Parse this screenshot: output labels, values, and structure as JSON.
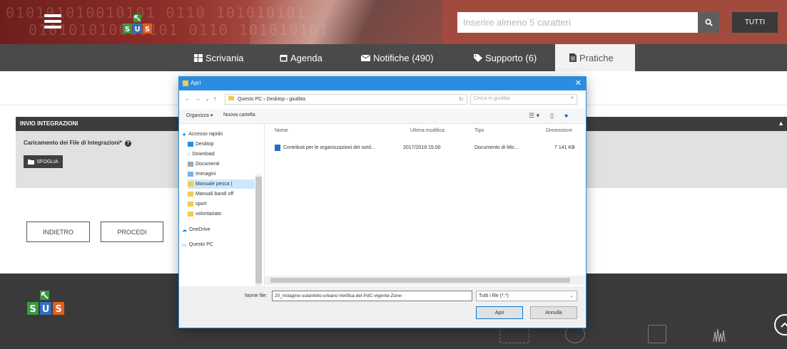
{
  "header": {
    "binary_bg": "010101010010101 0110 101010101",
    "search_placeholder": "Inserire almeno 5 caratteri",
    "search_icon": "search-icon",
    "scope_label": "TUTTI",
    "logo_letters": [
      "S",
      "U",
      "S"
    ]
  },
  "nav": {
    "items": [
      {
        "label": "Scrivania",
        "icon": "grid-icon"
      },
      {
        "label": "Agenda",
        "icon": "calendar-icon"
      },
      {
        "label": "Notifiche (490)",
        "icon": "envelope-icon"
      },
      {
        "label": "Supporto (6)",
        "icon": "tag-icon"
      },
      {
        "label": "Pratiche",
        "icon": "document-icon"
      }
    ]
  },
  "panel": {
    "title": "INVIO INTEGRAZIONI",
    "upload_label": "Caricamento dei File di Integrazioni*",
    "upload_button": "SFOGLIA"
  },
  "buttons": {
    "back": "INDIETRO",
    "next": "PROCEDI"
  },
  "dialog": {
    "title": "Apri",
    "close": "✕",
    "address": "Questo PC  ›  Desktop  ›  giuditta",
    "search_placeholder": "Cerca in giuditta",
    "toolbar": {
      "organize": "Organizza ▾",
      "new_folder": "Nuova cartella"
    },
    "tree": [
      {
        "label": "Accesso rapido",
        "icon": "star-icon"
      },
      {
        "label": "Desktop",
        "icon": "desktop-icon"
      },
      {
        "label": "Download",
        "icon": "download-icon"
      },
      {
        "label": "Documenti",
        "icon": "documents-icon"
      },
      {
        "label": "Immagini",
        "icon": "pictures-icon"
      },
      {
        "label": "Manuale pesca (",
        "icon": "folder-icon"
      },
      {
        "label": "Manuali bandi off",
        "icon": "folder-icon"
      },
      {
        "label": "sport",
        "icon": "folder-icon"
      },
      {
        "label": "volontariato",
        "icon": "folder-icon"
      },
      {
        "label": "OneDrive",
        "icon": "cloud-icon"
      },
      {
        "label": "Questo PC",
        "icon": "computer-icon"
      }
    ],
    "columns": [
      "Nome",
      "Ultima modifica",
      "Tipo",
      "Dimensione"
    ],
    "files": [
      {
        "name": "Contributi per le organizzazioni dei sord...",
        "modified": "2017/2019 15:00",
        "type": "Documento di Mic...",
        "size": "7 141 KB"
      }
    ],
    "filename_label": "Nome file:",
    "filename_value": "20_Indagine-sulambito-urbano-Verifica-del-PdC-vigente-Zone-",
    "filetype_value": "Tutti i file (*.*)",
    "open_button": "Apri",
    "cancel_button": "Annulla"
  },
  "colors": {
    "header_red": "#a0403a",
    "nav_gray": "#4a4a4a",
    "panel_dark": "#3d3d3d",
    "dialog_blue": "#2b8ce0",
    "logo_green": "#3a9a3e",
    "logo_blue": "#2f6fbf",
    "logo_orange": "#e0601f"
  }
}
